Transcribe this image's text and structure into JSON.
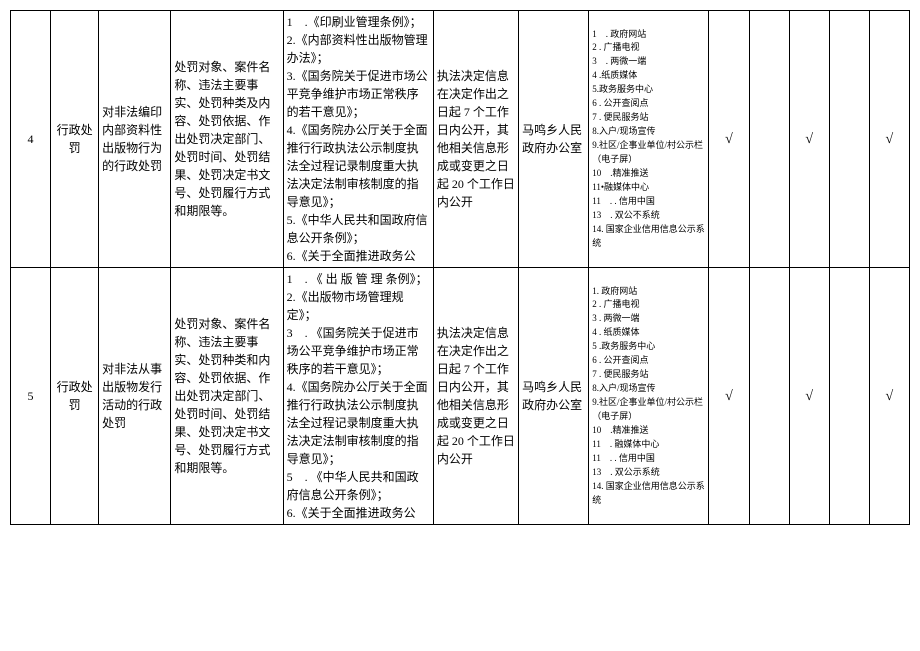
{
  "rows": [
    {
      "seq": "4",
      "category": "行政处罚",
      "matter": "对非法编印内部资料性出版物行为的行政处罚",
      "content": "处罚对象、案件名称、违法主要事实、处罚种类及内容、处罚依据、作出处罚决定部门、处罚时间、处罚结果、处罚决定书文号、处罚履行方式和期限等。",
      "basis": "1 .《印刷业管理条例》；\n2.《内部资料性出版物管理办法》；\n3.《国务院关于促进市场公平竞争维护市场正常秩序的若干意见》；\n4.《国务院办公厅关于全面推行行政执法公示制度执法全过程记录制度重大执法决定法制审核制度的指导意见》；\n5.《中华人民共和国政府信息公开条例》；\n6.《关于全面推进政务公",
      "time": "执法决定信息在决定作出之日起 7 个工作日内公开，其他相关信息形成或变更之日起 20 个工作日内公开",
      "subject": "马鸣乡人民政府办公室",
      "channel": "1 . 政府网站\n2 . 广播电视\n3 . 两微一端\n4 .纸质媒体\n5.政务服务中心\n6 . 公开查阅点\n7 . 便民服务站\n8.入户/现场宣传\n9.社区/企事业单位/村公示栏（电子屏）\n10 .精准推送\n11•融媒体中心\n11 . . 信用中国\n13 . 双公不系统\n14. 国家企业信用信息公示系统",
      "chk1": "√",
      "chk2": "",
      "chk3": "√",
      "chk4": "",
      "chk5": "√"
    },
    {
      "seq": "5",
      "category": "行政处罚",
      "matter": "对非法从事出版物发行活动的行政处罚",
      "content": "处罚对象、案件名称、违法主要事实、处罚种类和内容、处罚依据、作出处罚决定部门、处罚时间、处罚结果、处罚决定书文号、处罚履行方式和期限等。",
      "basis": "1 . 《 出 版 管 理 条例》；\n2.《出版物市场管理规定》；\n3 . 《国务院关于促进市场公平竞争维护市场正常秩序的若干意见》；\n4.《国务院办公厅关于全面推行行政执法公示制度执法全过程记录制度重大执法决定法制审核制度的指导意见》；\n5 . 《中华人民共和国政府信息公开条例》；\n6.《关于全面推进政务公",
      "time": "执法决定信息在决定作出之日起 7 个工作日内公开，其他相关信息形成或变更之日起 20 个工作日内公开",
      "subject": "马鸣乡人民政府办公室",
      "channel": "1. 政府网站\n2 . 广播电视\n3 . 两微一端\n4 . 纸质媒体\n5 .政务服务中心\n6 . 公开查阅点\n7 . 便民服务站\n8.入户/现场宣传\n9.社区/企事业单位/村公示栏（电子屏）\n10 .精准推送\n11 . 融媒体中心\n11 . . 信用中国\n13 . 双公示系统\n14. 国家企业信用信息公示系统",
      "chk1": "√",
      "chk2": "",
      "chk3": "√",
      "chk4": "",
      "chk5": "√"
    }
  ]
}
